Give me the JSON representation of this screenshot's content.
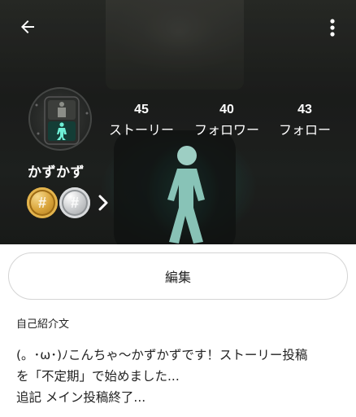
{
  "header": {
    "back_icon": "arrow-left-icon",
    "more_icon": "more-vert-icon",
    "avatar_icon": "pedestrian-signal-avatar"
  },
  "profile": {
    "username": "かずかず",
    "stats": [
      {
        "count": "45",
        "label": "ストーリー"
      },
      {
        "count": "40",
        "label": "フォロワー"
      },
      {
        "count": "43",
        "label": "フォロー"
      }
    ],
    "badges": [
      {
        "type": "gold",
        "icon": "hash-coin-icon",
        "color": "#d9a43a"
      },
      {
        "type": "silver",
        "icon": "hash-coin-icon",
        "color": "#c9cbcd"
      }
    ],
    "badges_more_icon": "chevron-right-icon"
  },
  "actions": {
    "edit_label": "編集"
  },
  "bio": {
    "title": "自己紹介文",
    "lines": [
      "(。･ω･)ﾉこんちゃ〜かずかずです！ストーリー投稿",
      "を「不定期」で始めました...",
      "追記 メイン投稿終了..."
    ]
  },
  "colors": {
    "signal_green": "#5fd4bf",
    "header_dark": "#1f211f",
    "text": "#222222",
    "button_border": "#d4d4d4"
  }
}
